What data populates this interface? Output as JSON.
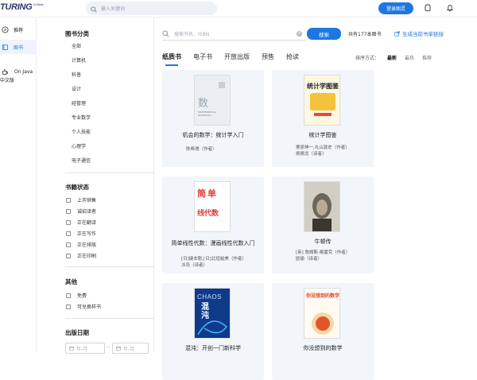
{
  "header": {
    "logo_text": "TURING",
    "logo_version": "2.0 Beta",
    "search_placeholder": "输入关键词",
    "login_label": "登录图灵"
  },
  "leftnav": {
    "items": [
      {
        "label": "推荐"
      },
      {
        "label": "图书"
      }
    ],
    "extra_line1": "On Java",
    "extra_line2": "中文版"
  },
  "sidebar": {
    "category_title": "图书分类",
    "categories": [
      "全部",
      "计算机",
      "科普",
      "设计",
      "经管理",
      "专业数学",
      "个人技能",
      "心理学",
      "电子通信"
    ],
    "status_title": "书籍状态",
    "status_options": [
      "上市销售",
      "诚招译者",
      "正在翻译",
      "正在写作",
      "正在排版",
      "正在印刷"
    ],
    "other_title": "其他",
    "other_options": [
      "免费",
      "可兑换样书"
    ],
    "date_title": "出版日期",
    "date_from_placeholder": "年-月",
    "date_to_placeholder": "年-月",
    "date_sep": "–"
  },
  "main": {
    "search_placeholder": "搜索书名、ISBN",
    "search_button": "搜索",
    "count_text": "共有177本图书",
    "gen_link": "生成当前书单链接",
    "tabs": [
      "纸质书",
      "电子书",
      "开放出版",
      "预售",
      "抢读"
    ],
    "sort_label": "排序方式：",
    "sort_options": [
      "最新",
      "最热",
      "推荐"
    ],
    "books": [
      {
        "title": "机会的数学：统计学入门",
        "author1": "陈希孺（作者）",
        "author2": ""
      },
      {
        "title": "统计学图鉴",
        "author1": "栗原伸一,丸山敦史（作者）",
        "author2": "侯振龙（译者）"
      },
      {
        "title": "简单线性代数：漫画线性代数入门",
        "author1": "[日]键本聪,[日]北垣絵美（作者）",
        "author2": "冰岛（译者）"
      },
      {
        "title": "牛顿传",
        "author1": "[英] 詹姆斯·格雷克（作者）",
        "author2": "欧瑜（译者）"
      },
      {
        "title": "混沌：开创一门新科学",
        "author1": "",
        "author2": ""
      },
      {
        "title": "你没想到的数学",
        "author1": "",
        "author2": ""
      }
    ],
    "covers": {
      "c1_top": "数",
      "c1_sub": "MATHEMATICAL STATISTICS",
      "c2_title": "统计学图鉴",
      "c3_top": "简单",
      "c3_bottom": "线代数",
      "c6_title": "你没想到的数学",
      "c5_en": "CHAOS",
      "c5_cn": "混沌"
    }
  }
}
